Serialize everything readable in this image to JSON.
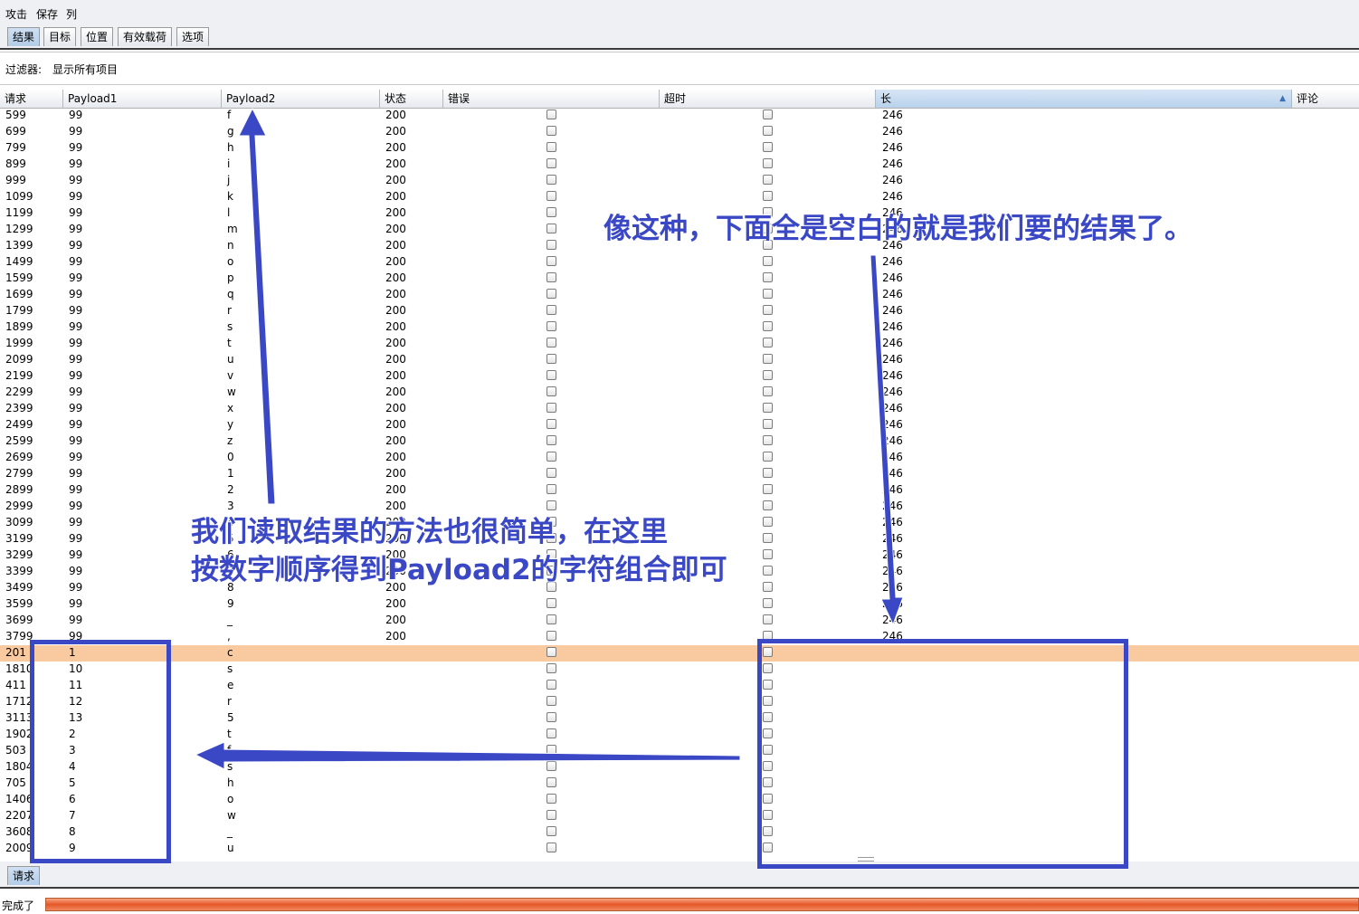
{
  "menu": [
    "攻击",
    "保存",
    "列"
  ],
  "tabs": [
    "结果",
    "目标",
    "位置",
    "有效载荷",
    "选项"
  ],
  "active_tab": "结果",
  "filter": {
    "label": "过滤器:",
    "value": "显示所有项目"
  },
  "columns": [
    "请求",
    "Payload1",
    "Payload2",
    "状态",
    "错误",
    "超时",
    "长",
    "评论"
  ],
  "sorted_column": "长",
  "rows": [
    {
      "req": "599",
      "p1": "99",
      "p2": "f",
      "status": "200",
      "length": "246"
    },
    {
      "req": "699",
      "p1": "99",
      "p2": "g",
      "status": "200",
      "length": "246"
    },
    {
      "req": "799",
      "p1": "99",
      "p2": "h",
      "status": "200",
      "length": "246"
    },
    {
      "req": "899",
      "p1": "99",
      "p2": "i",
      "status": "200",
      "length": "246"
    },
    {
      "req": "999",
      "p1": "99",
      "p2": "j",
      "status": "200",
      "length": "246"
    },
    {
      "req": "1099",
      "p1": "99",
      "p2": "k",
      "status": "200",
      "length": "246"
    },
    {
      "req": "1199",
      "p1": "99",
      "p2": "l",
      "status": "200",
      "length": "246"
    },
    {
      "req": "1299",
      "p1": "99",
      "p2": "m",
      "status": "200",
      "length": "246"
    },
    {
      "req": "1399",
      "p1": "99",
      "p2": "n",
      "status": "200",
      "length": "246"
    },
    {
      "req": "1499",
      "p1": "99",
      "p2": "o",
      "status": "200",
      "length": "246"
    },
    {
      "req": "1599",
      "p1": "99",
      "p2": "p",
      "status": "200",
      "length": "246"
    },
    {
      "req": "1699",
      "p1": "99",
      "p2": "q",
      "status": "200",
      "length": "246"
    },
    {
      "req": "1799",
      "p1": "99",
      "p2": "r",
      "status": "200",
      "length": "246"
    },
    {
      "req": "1899",
      "p1": "99",
      "p2": "s",
      "status": "200",
      "length": "246"
    },
    {
      "req": "1999",
      "p1": "99",
      "p2": "t",
      "status": "200",
      "length": "246"
    },
    {
      "req": "2099",
      "p1": "99",
      "p2": "u",
      "status": "200",
      "length": "246"
    },
    {
      "req": "2199",
      "p1": "99",
      "p2": "v",
      "status": "200",
      "length": "246"
    },
    {
      "req": "2299",
      "p1": "99",
      "p2": "w",
      "status": "200",
      "length": "246"
    },
    {
      "req": "2399",
      "p1": "99",
      "p2": "x",
      "status": "200",
      "length": "246"
    },
    {
      "req": "2499",
      "p1": "99",
      "p2": "y",
      "status": "200",
      "length": "246"
    },
    {
      "req": "2599",
      "p1": "99",
      "p2": "z",
      "status": "200",
      "length": "246"
    },
    {
      "req": "2699",
      "p1": "99",
      "p2": "0",
      "status": "200",
      "length": "246"
    },
    {
      "req": "2799",
      "p1": "99",
      "p2": "1",
      "status": "200",
      "length": "246"
    },
    {
      "req": "2899",
      "p1": "99",
      "p2": "2",
      "status": "200",
      "length": "246"
    },
    {
      "req": "2999",
      "p1": "99",
      "p2": "3",
      "status": "200",
      "length": "246"
    },
    {
      "req": "3099",
      "p1": "99",
      "p2": "4",
      "status": "200",
      "length": "246"
    },
    {
      "req": "3199",
      "p1": "99",
      "p2": "5",
      "status": "200",
      "length": "246"
    },
    {
      "req": "3299",
      "p1": "99",
      "p2": "6",
      "status": "200",
      "length": "246"
    },
    {
      "req": "3399",
      "p1": "99",
      "p2": "7",
      "status": "200",
      "length": "246"
    },
    {
      "req": "3499",
      "p1": "99",
      "p2": "8",
      "status": "200",
      "length": "246"
    },
    {
      "req": "3599",
      "p1": "99",
      "p2": "9",
      "status": "200",
      "length": "246"
    },
    {
      "req": "3699",
      "p1": "99",
      "p2": "_",
      "status": "200",
      "length": "246"
    },
    {
      "req": "3799",
      "p1": "99",
      "p2": ",",
      "status": "200",
      "length": "246"
    },
    {
      "req": "201",
      "p1": "1",
      "p2": "c",
      "status": "",
      "length": "",
      "highlight": true
    },
    {
      "req": "1810",
      "p1": "10",
      "p2": "s",
      "status": "",
      "length": ""
    },
    {
      "req": "411",
      "p1": "11",
      "p2": "e",
      "status": "",
      "length": ""
    },
    {
      "req": "1712",
      "p1": "12",
      "p2": "r",
      "status": "",
      "length": ""
    },
    {
      "req": "3113",
      "p1": "13",
      "p2": "5",
      "status": "",
      "length": ""
    },
    {
      "req": "1902",
      "p1": "2",
      "p2": "t",
      "status": "",
      "length": ""
    },
    {
      "req": "503",
      "p1": "3",
      "p2": "f",
      "status": "",
      "length": ""
    },
    {
      "req": "1804",
      "p1": "4",
      "p2": "s",
      "status": "",
      "length": ""
    },
    {
      "req": "705",
      "p1": "5",
      "p2": "h",
      "status": "",
      "length": ""
    },
    {
      "req": "1406",
      "p1": "6",
      "p2": "o",
      "status": "",
      "length": ""
    },
    {
      "req": "2207",
      "p1": "7",
      "p2": "w",
      "status": "",
      "length": ""
    },
    {
      "req": "3608",
      "p1": "8",
      "p2": "_",
      "status": "",
      "length": ""
    },
    {
      "req": "2009",
      "p1": "9",
      "p2": "u",
      "status": "",
      "length": ""
    }
  ],
  "bottom_tab": "请求",
  "status": {
    "text": "完成了",
    "progress": 1.0
  },
  "annotations": {
    "note1": "像这种，下面全是空白的就是我们要的结果了。",
    "note2_line1": "我们读取结果的方法也很简单，在这里",
    "note2_line2": "按数字顺序得到Payload2的字符组合即可",
    "color": "#3b48c6"
  },
  "colors": {
    "highlight_row": "#f9c9a0",
    "progress": "#e5582a"
  }
}
